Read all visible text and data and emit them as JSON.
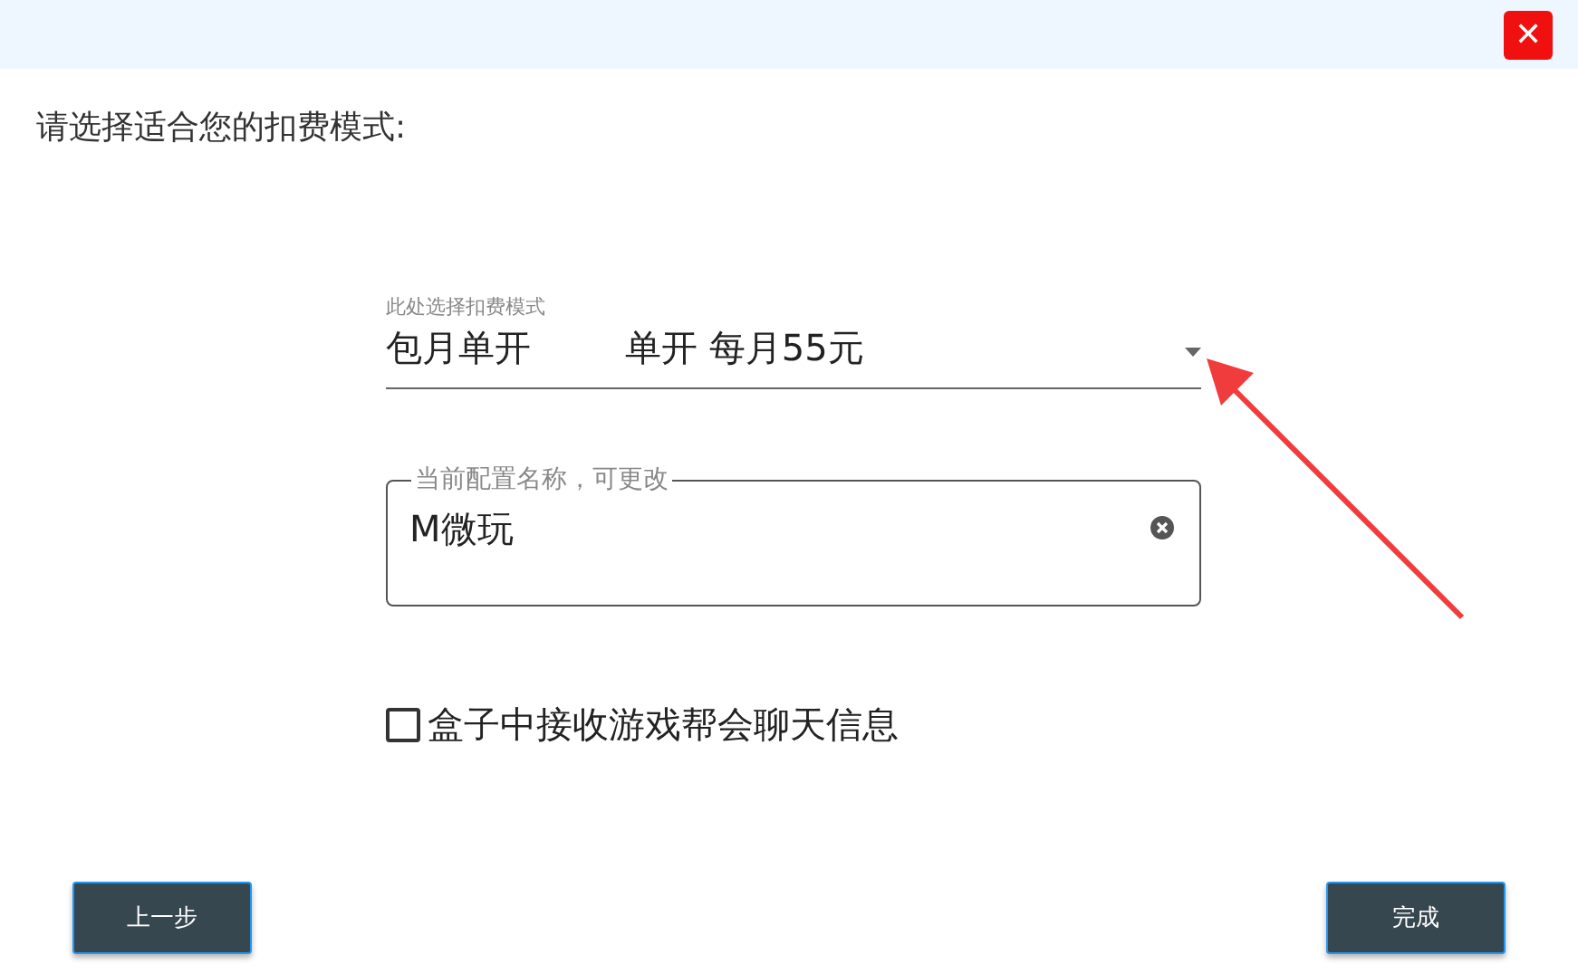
{
  "title_bar": {
    "close": "✕"
  },
  "prompt": "请选择适合您的扣费模式:",
  "mode_select": {
    "label": "此处选择扣费模式",
    "value_parts": [
      "包月单开",
      "单开 每月55元"
    ]
  },
  "name_field": {
    "label": "当前配置名称，可更改",
    "value": "M微玩"
  },
  "chat_checkbox": {
    "label": "盒子中接收游戏帮会聊天信息",
    "checked": false
  },
  "buttons": [
    {
      "label": "上一步"
    },
    {
      "label": "完成"
    }
  ]
}
